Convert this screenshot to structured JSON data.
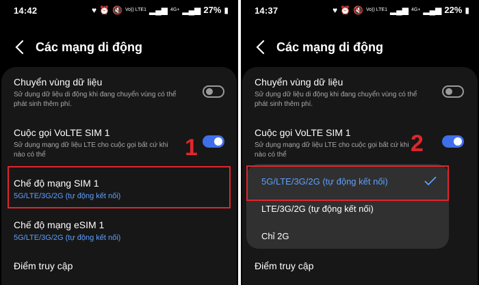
{
  "left": {
    "status": {
      "time": "14:42",
      "battery": "27%",
      "net1": "Vo)) LTE1",
      "net2": "4G+"
    },
    "header": {
      "title": "Các mạng di động"
    },
    "items": {
      "roaming": {
        "label": "Chuyển vùng dữ liệu",
        "desc": "Sử dụng dữ liệu di động khi đang chuyển vùng có thể phát sinh thêm phí.",
        "toggle": "off"
      },
      "volte": {
        "label": "Cuộc gọi VoLTE SIM 1",
        "desc": "Sử dụng mạng dữ liệu LTE cho cuộc gọi bất cứ khi nào có thể",
        "toggle": "on"
      },
      "mode_sim1": {
        "label": "Chế độ mạng SIM 1",
        "value": "5G/LTE/3G/2G (tự động kết nối)"
      },
      "mode_esim1": {
        "label": "Chế độ mạng eSIM 1",
        "value": "5G/LTE/3G/2G (tự động kết nối)"
      },
      "access_point": {
        "label": "Điểm truy cập"
      }
    },
    "annotation": "1"
  },
  "right": {
    "status": {
      "time": "14:37",
      "battery": "22%",
      "net1": "Vo)) LTE1",
      "net2": "4G+"
    },
    "header": {
      "title": "Các mạng di động"
    },
    "items": {
      "roaming": {
        "label": "Chuyển vùng dữ liệu",
        "desc": "Sử dụng dữ liệu di động khi đang chuyển vùng có thể phát sinh thêm phí.",
        "toggle": "off"
      },
      "volte": {
        "label": "Cuộc gọi VoLTE SIM 1",
        "desc": "Sử dụng mạng dữ liệu LTE cho cuộc gọi bất cứ khi nào có thể",
        "toggle": "on"
      },
      "access_point": {
        "label": "Điểm truy cập"
      }
    },
    "menu": {
      "options": [
        "5G/LTE/3G/2G (tự động kết nối)",
        "LTE/3G/2G (tự động kết nối)",
        "Chỉ 2G"
      ],
      "selected_index": 0
    },
    "annotation": "2"
  },
  "colors": {
    "accent": "#5ea0ff",
    "toggle_on": "#3f6fe8",
    "highlight": "#e1262c",
    "card": "#171717",
    "popup": "#303030"
  }
}
